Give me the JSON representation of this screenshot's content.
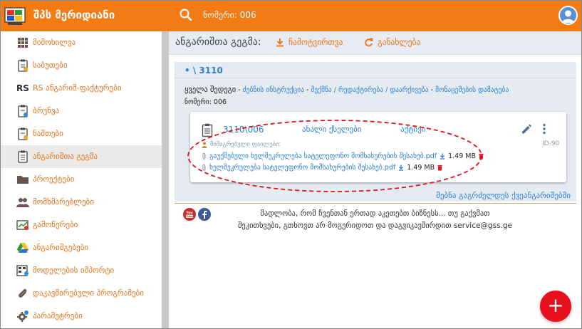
{
  "app": {
    "title": "შპს მერიდიანი",
    "number_label": "ნომერი: 006"
  },
  "sidebar": {
    "items": [
      {
        "label": "მიმოხილვა",
        "icon": "dashboard-icon"
      },
      {
        "label": "საბუთები",
        "icon": "documents-icon"
      },
      {
        "label": "RS ანგარიშ-ფაქტურები",
        "icon": "rs-invoice-icon",
        "prefix": "RS"
      },
      {
        "label": "ბრუნვა",
        "icon": "turnover-icon"
      },
      {
        "label": "ნაშთები",
        "icon": "balances-icon"
      },
      {
        "label": "ანგარიშთა გეგმა",
        "icon": "chart-of-accounts-icon",
        "active": true
      },
      {
        "label": "პროექტები",
        "icon": "folder-icon"
      },
      {
        "label": "მომხმარებლები",
        "icon": "users-icon"
      },
      {
        "label": "გამოწერები",
        "icon": "subscriptions-icon"
      },
      {
        "label": "ანგარიშგებები",
        "icon": "drive-icon"
      },
      {
        "label": "მოდელების იმპორტი",
        "icon": "import-icon"
      },
      {
        "label": "დაკავშირებული პროგრამები",
        "icon": "paperclip-icon"
      },
      {
        "label": "პარამეტრები",
        "icon": "settings-icon"
      }
    ]
  },
  "toolbar": {
    "title": "ანგარიშთა გეგმა:",
    "download_label": "ჩამოტვირთვა",
    "refresh_label": "განახლება"
  },
  "content": {
    "breadcrumb": "• \\ 3110",
    "path": {
      "first": "ყველა შედეგი",
      "links": [
        "ძებნის ინსტრუქცია",
        "შექმნა / რედაქტირება / დაარქივება",
        "მონაცემების დამატება"
      ]
    },
    "number_line": "ნომერი: 006"
  },
  "card": {
    "account": "3110\\006",
    "status": "ახალი ქსელები",
    "type": "აქტივი",
    "id": "ID-90",
    "attached_label": "მიმაგრებული ფაილები:",
    "files": [
      {
        "name": "გაუქმებული ხელშეკრულება სატელეფონო მომსახურების შესახებ.pdf",
        "size": "1.49 MB"
      },
      {
        "name": "ხელშეკრულება სატელეფონო მომსახურების შესახებ.pdf",
        "size": "1.49 MB"
      }
    ]
  },
  "load_more": "მებნა გაგრძელდეს ქვეანგარიშებში",
  "footer": {
    "line1": "მადლობა, რომ ჩვენთან ერთად აკეთებთ ბიზნესს... თუ გაქვმათ",
    "line2": "შეკითხვები, გთხოვთ არ მოგერიდოთ და დაგვიკავშირდით service@gss.ge"
  },
  "fab_label": "+",
  "colors": {
    "accent": "#f47a14",
    "link": "#2b7fd4",
    "fab": "#e8101c"
  }
}
